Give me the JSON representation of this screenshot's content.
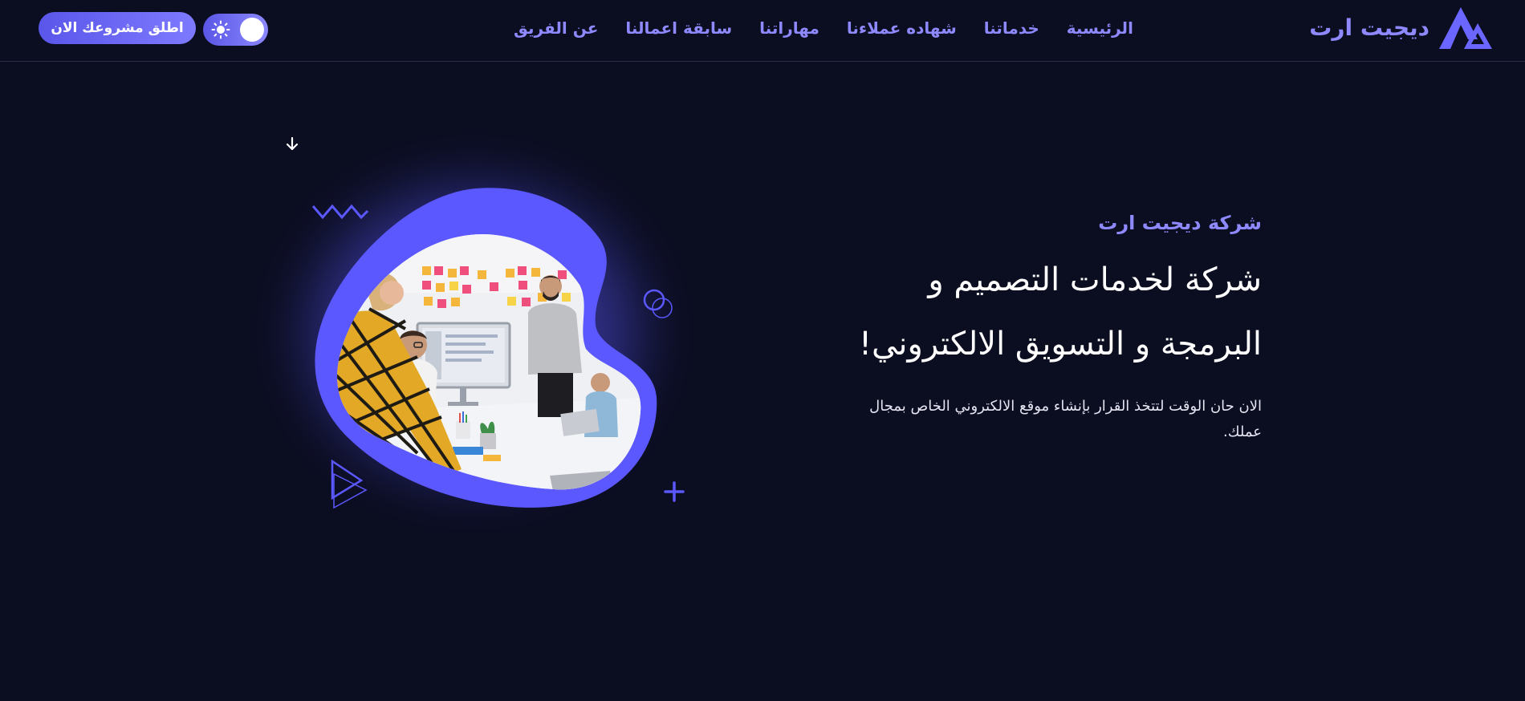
{
  "header": {
    "logo_text": "ديجيت ارت",
    "nav": [
      "الرئيسية",
      "خدماتنا",
      "شهاده عملاءنا",
      "مهاراتنا",
      "سابقة اعمالنا",
      "عن الفريق"
    ],
    "cta_label": "اطلق مشروعك الان",
    "theme_toggle": {
      "icon": "sun-icon"
    }
  },
  "hero": {
    "eyebrow": "شركة ديجيت ارت",
    "headline_line1": "شركة لخدمات التصميم و",
    "headline_line2": "البرمجة و التسويق الالكتروني!",
    "description": "الان حان الوقت لتتخذ القرار بإنشاء موقع الالكتروني الخاص بمجال عملك."
  },
  "colors": {
    "background": "#0b0d20",
    "accent": "#8e89ff",
    "accent_strong": "#5b58ff"
  }
}
